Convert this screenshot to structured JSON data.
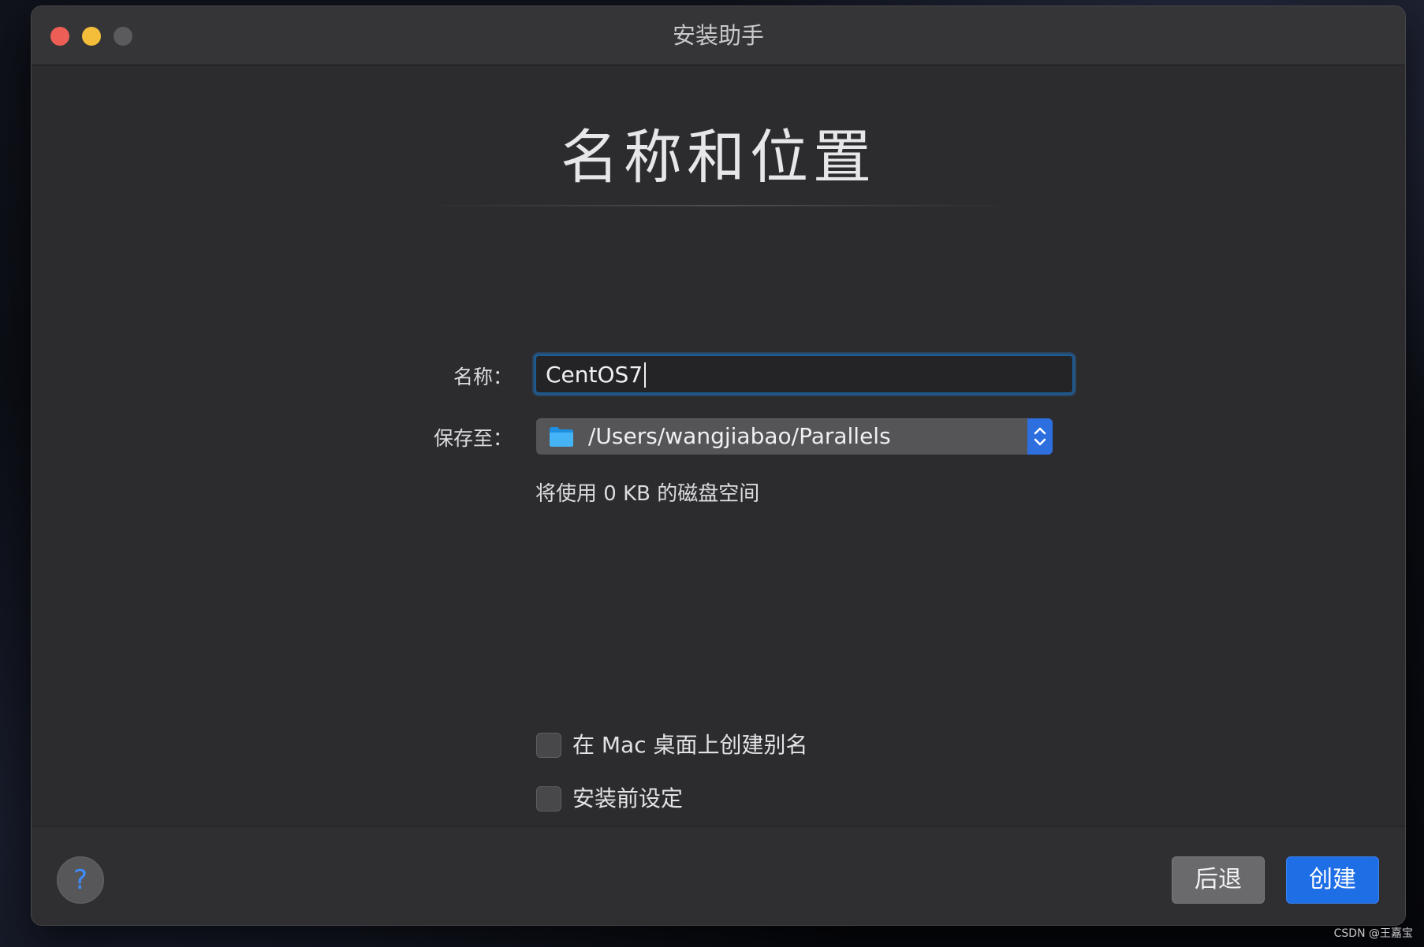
{
  "window": {
    "title": "安装助手"
  },
  "page": {
    "heading": "名称和位置"
  },
  "form": {
    "name_label": "名称：",
    "name_value": "CentOS7",
    "location_label": "保存至：",
    "location_value": "/Users/wangjiabao/Parallels",
    "disk_usage": "将使用 0 KB 的磁盘空间"
  },
  "options": [
    {
      "label": "在 Mac 桌面上创建别名",
      "checked": false
    },
    {
      "label": "安装前设定",
      "checked": false
    }
  ],
  "footer": {
    "help_label": "?",
    "back_label": "后退",
    "create_label": "创建"
  },
  "watermark": "CSDN @王嘉宝",
  "colors": {
    "accent": "#1e6ee6",
    "window_bg": "#2c2c2e",
    "traffic_close": "#ed5f56",
    "traffic_minimize": "#f4be3b"
  },
  "icons": {
    "location_select": "folder-icon",
    "location_stepper": "chevron-up-down-icon"
  }
}
